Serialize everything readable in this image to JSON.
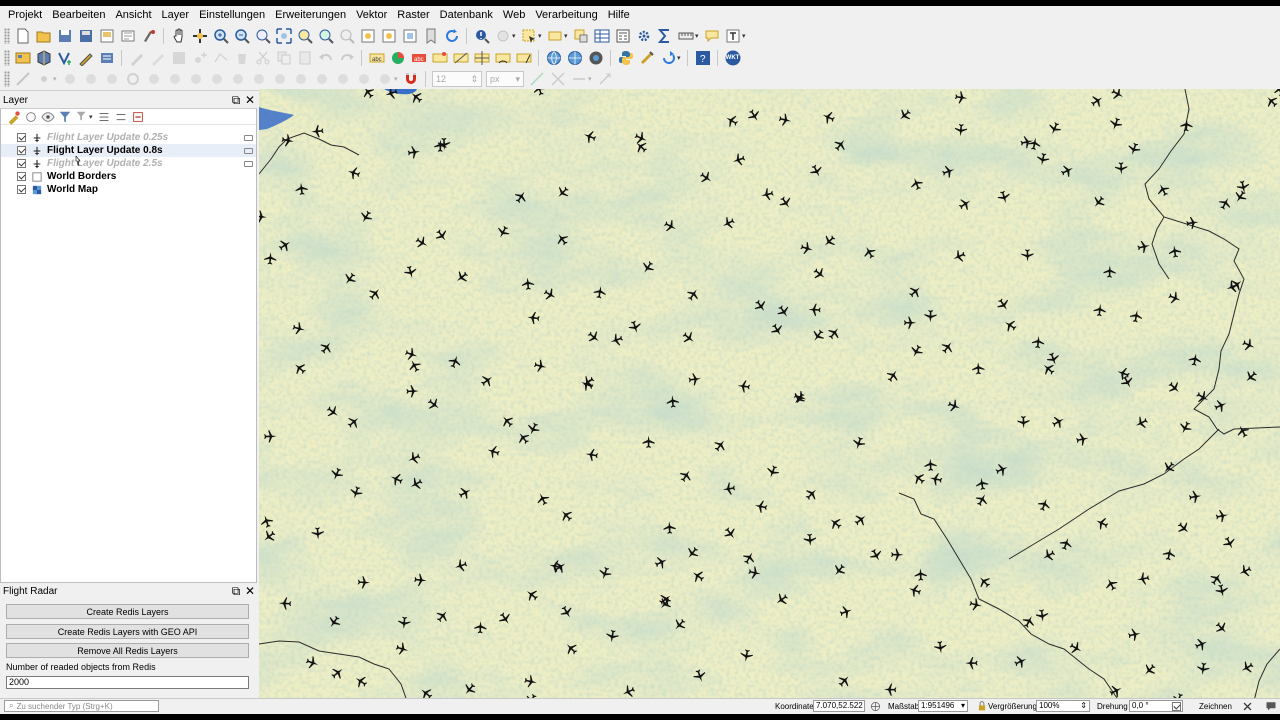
{
  "menu": [
    "Projekt",
    "Bearbeiten",
    "Ansicht",
    "Layer",
    "Einstellungen",
    "Erweiterungen",
    "Vektor",
    "Raster",
    "Datenbank",
    "Web",
    "Verarbeitung",
    "Hilfe"
  ],
  "toolbar": {
    "font_size_value": "12",
    "font_unit_value": "px",
    "wkt_label": "WKT"
  },
  "layers_panel": {
    "title": "Layer",
    "layers": [
      {
        "name": "Flight Layer Update 0.25s",
        "checked": true,
        "greyed": true
      },
      {
        "name": "Flight Layer Update 0.8s",
        "checked": true,
        "greyed": false
      },
      {
        "name": "Flight Layer Update 2.5s",
        "checked": true,
        "greyed": true
      },
      {
        "name": "World Borders",
        "checked": true,
        "greyed": false
      },
      {
        "name": "World Map",
        "checked": true,
        "greyed": false
      }
    ]
  },
  "flight_radar": {
    "title": "Flight Radar",
    "btn_create": "Create Redis Layers",
    "btn_create_geo": "Create Redis Layers with GEO API",
    "btn_remove": "Remove All Redis Layers",
    "count_label": "Number of readed objects from Redis",
    "count_value": "2000"
  },
  "status": {
    "search_placeholder": "Zu suchender Typ (Strg+K)",
    "coord_label": "Koordinate",
    "coord_value": "7.070,52.522",
    "scale_label": "Maßstab",
    "scale_value": "1:951496",
    "magnifier_label": "Vergrößerung",
    "magnifier_value": "100%",
    "rotation_label": "Drehung",
    "rotation_value": "0,0 °",
    "render_label": "Zeichnen"
  },
  "colors": {
    "map_base": "#eeeec5",
    "map_green": "#aac8a0",
    "border_line": "#2a2a2a",
    "water": "#3a6fc9",
    "plane": "#111111"
  }
}
